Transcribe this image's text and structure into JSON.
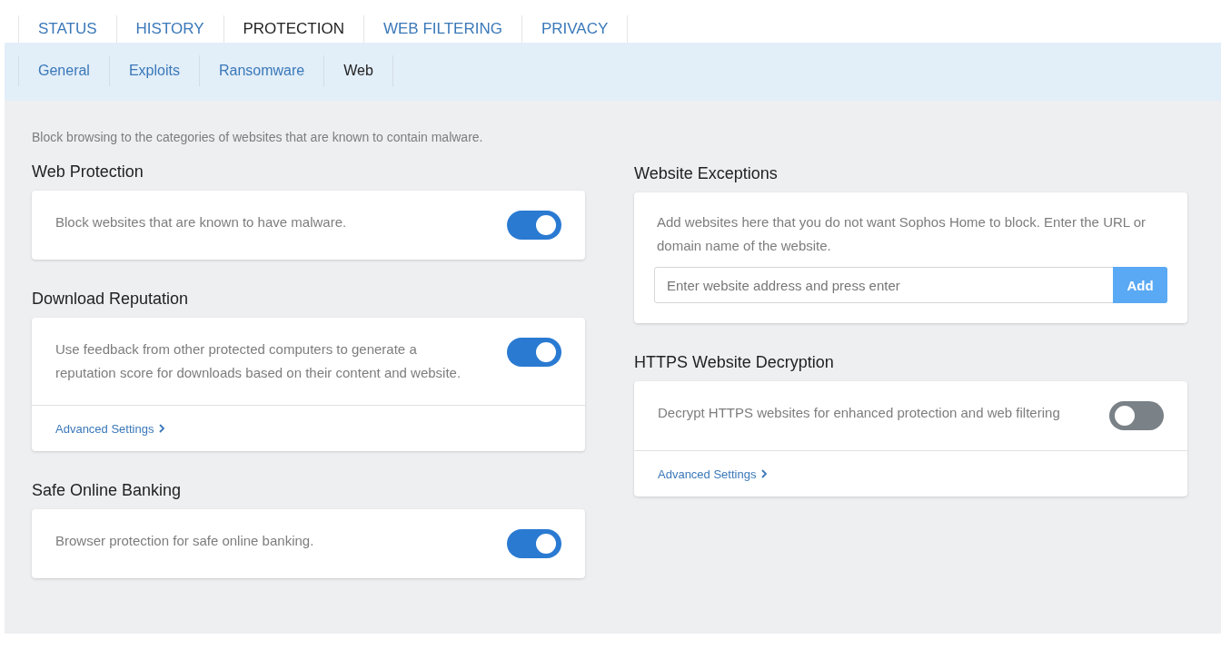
{
  "tabs": [
    {
      "label": "STATUS",
      "selected": false
    },
    {
      "label": "HISTORY",
      "selected": false
    },
    {
      "label": "PROTECTION",
      "selected": true
    },
    {
      "label": "WEB FILTERING",
      "selected": false
    },
    {
      "label": "PRIVACY",
      "selected": false
    }
  ],
  "subtabs": [
    {
      "label": "General",
      "selected": false
    },
    {
      "label": "Exploits",
      "selected": false
    },
    {
      "label": "Ransomware",
      "selected": false
    },
    {
      "label": "Web",
      "selected": true
    }
  ],
  "intro": "Block browsing to the categories of websites that are known to contain malware.",
  "left_sections": [
    {
      "kind": "toggle",
      "title": "Web Protection",
      "text": "Block websites that are known to have malware.",
      "on": true
    },
    {
      "kind": "toggle",
      "title": "Download Reputation",
      "text": "Use feedback from other protected computers to generate a reputation score for downloads based on their content and website.",
      "on": true,
      "link": "Advanced Settings"
    },
    {
      "kind": "toggle",
      "title": "Safe Online Banking",
      "text": "Browser protection for safe online banking.",
      "on": true
    }
  ],
  "right_sections": [
    {
      "kind": "exceptions",
      "title": "Website Exceptions",
      "text": "Add websites here that you do not want Sophos Home to block. Enter the URL or domain name of the website.",
      "placeholder": "Enter website address and press enter",
      "button": "Add"
    },
    {
      "kind": "toggle",
      "title": "HTTPS Website Decryption",
      "text": "Decrypt HTTPS websites for enhanced protection and web filtering",
      "on": false,
      "link": "Advanced Settings"
    }
  ]
}
